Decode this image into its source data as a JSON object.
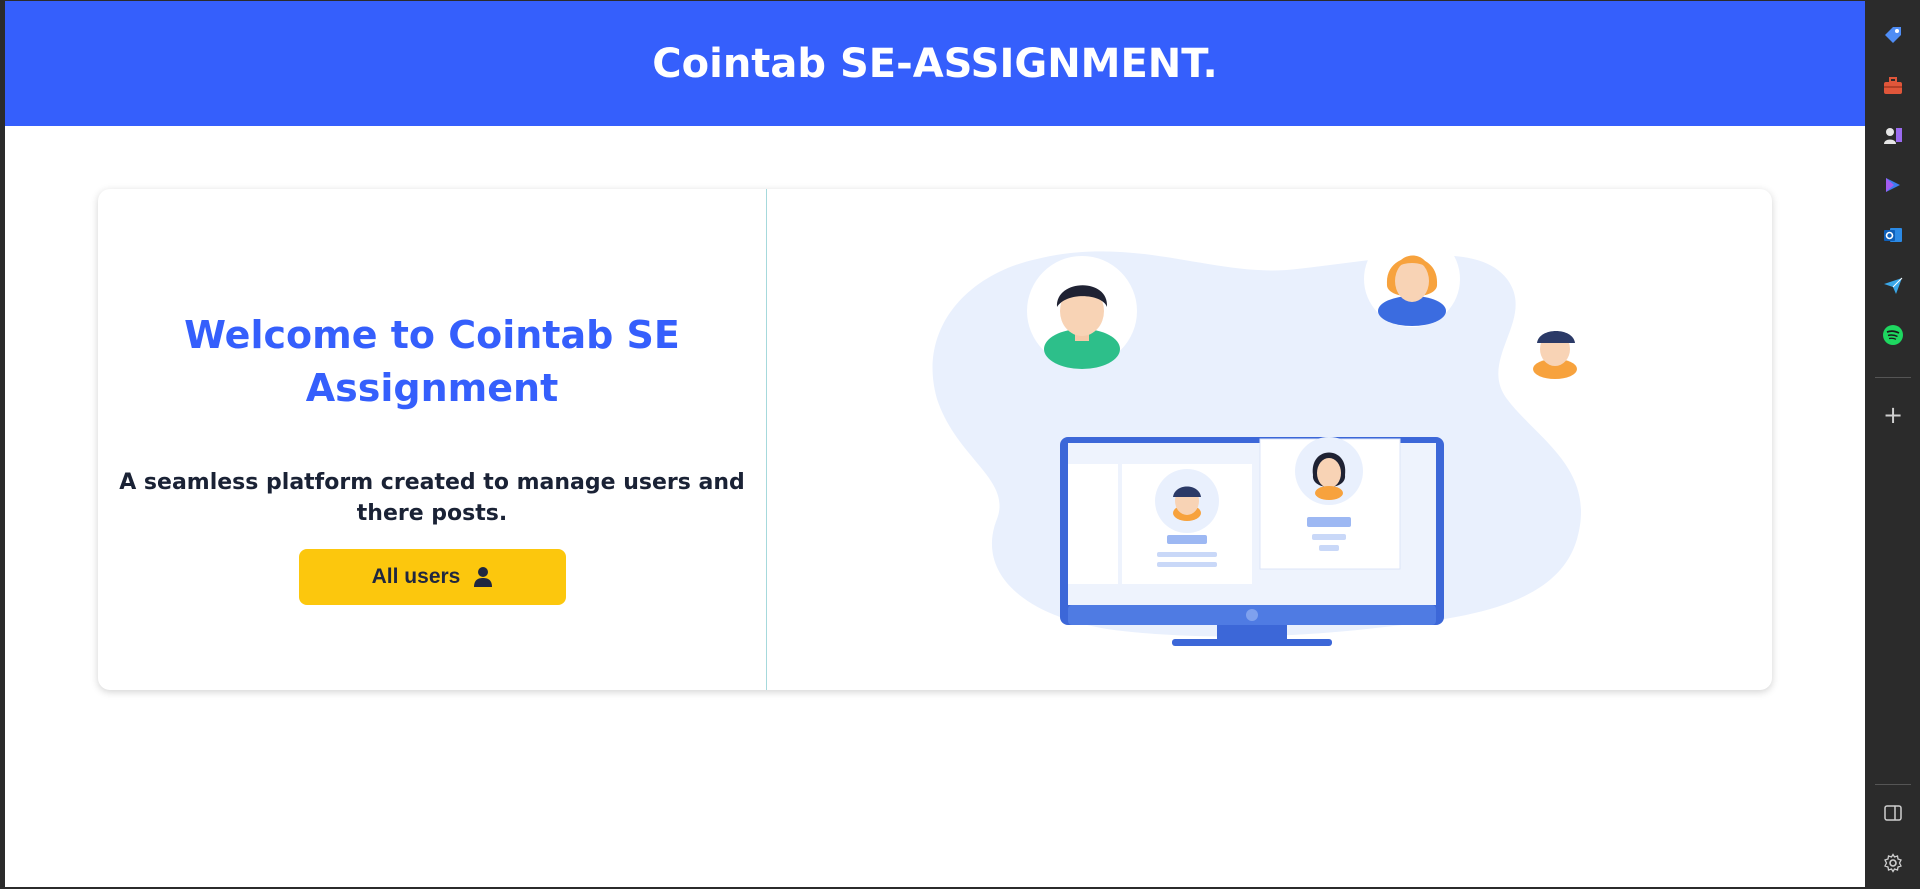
{
  "header": {
    "title": "Cointab SE-ASSIGNMENT."
  },
  "hero": {
    "title": "Welcome to Cointab SE Assignment",
    "tagline": "A seamless platform created to manage users and there posts.",
    "button_label": "All users",
    "button_icon": "user-icon"
  },
  "colors": {
    "header_bg": "#355ffc",
    "title": "#355ffc",
    "button_bg": "#fcc70d",
    "text_dark": "#1a2235"
  },
  "browser_sidebar": {
    "items": [
      {
        "name": "tag-icon"
      },
      {
        "name": "briefcase-icon"
      },
      {
        "name": "chess-games-icon"
      },
      {
        "name": "copilot-icon"
      },
      {
        "name": "outlook-icon"
      },
      {
        "name": "paper-plane-icon"
      },
      {
        "name": "spotify-icon"
      }
    ],
    "add_label": "+",
    "panel_icon": "sidebar-panel-icon",
    "settings_icon": "settings-gear-icon"
  }
}
